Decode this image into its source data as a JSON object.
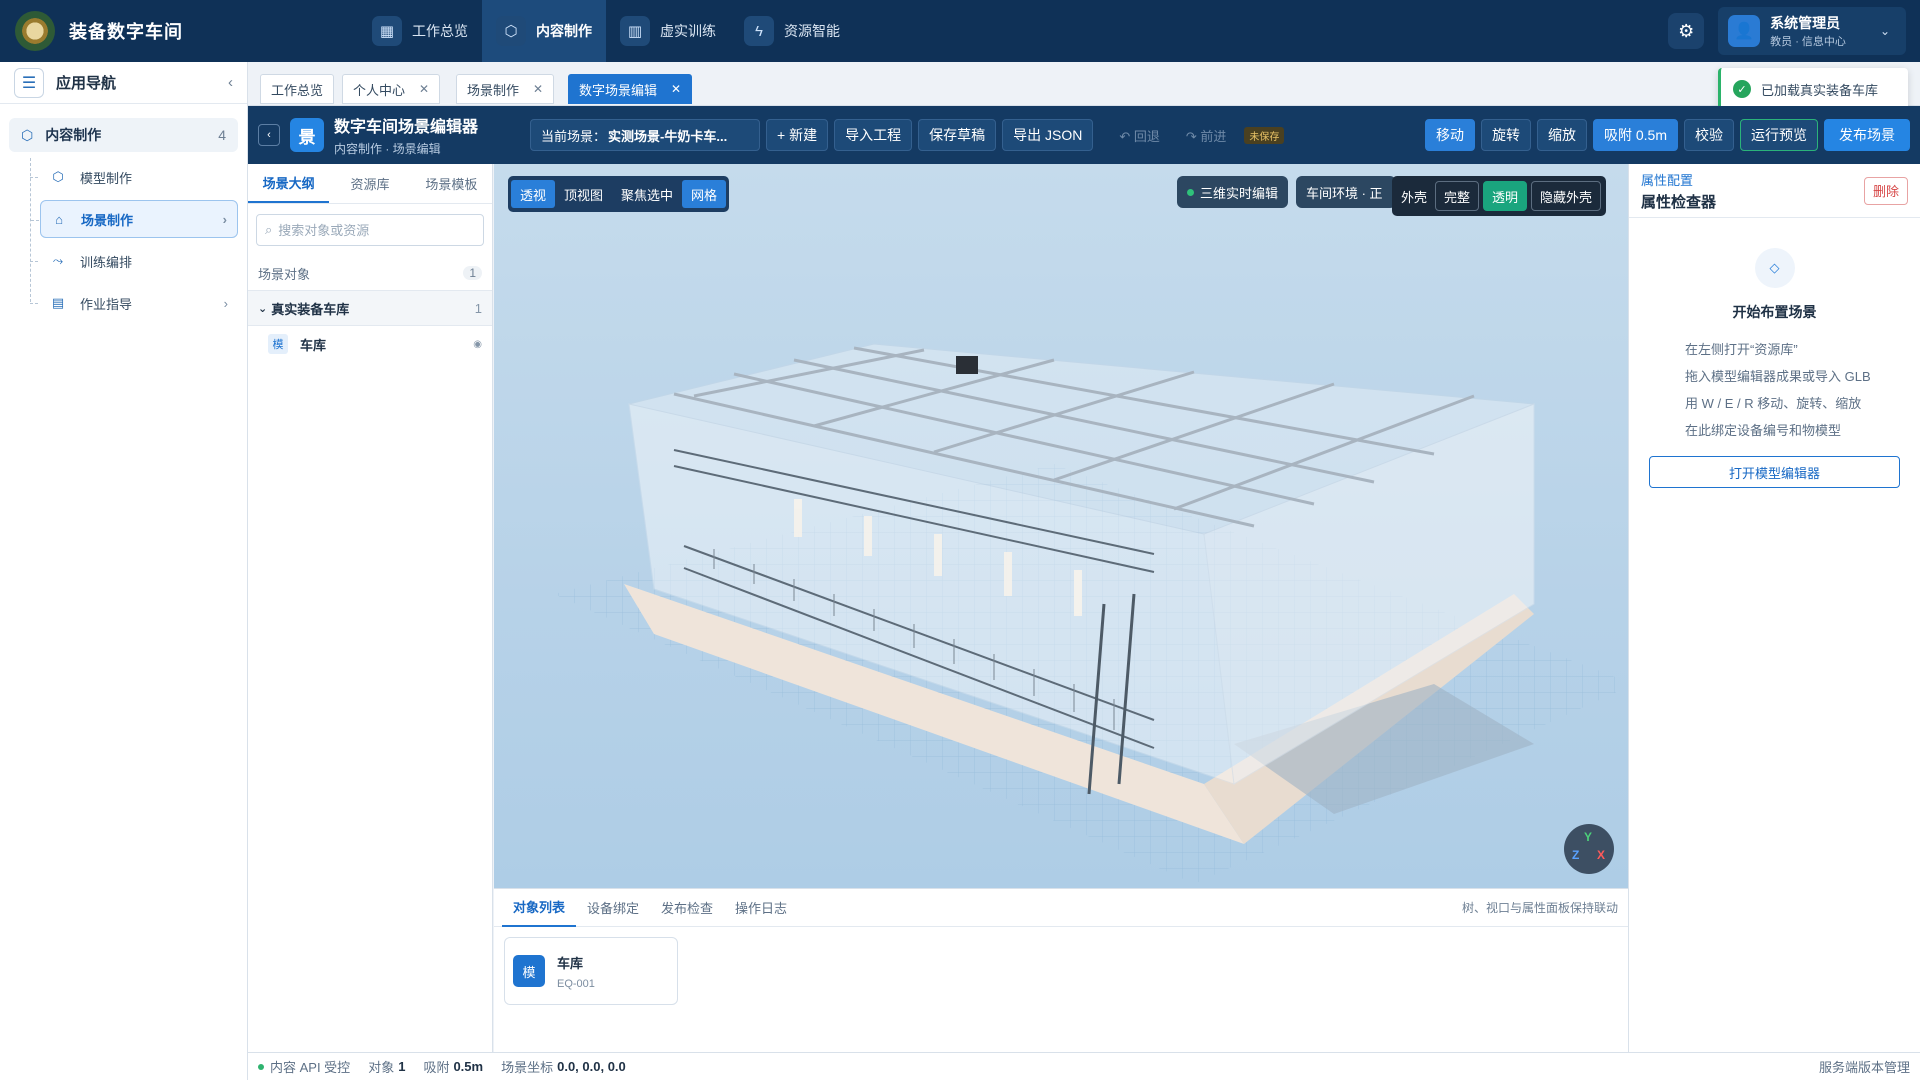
{
  "app": {
    "title": "装备数字车间"
  },
  "topnav": [
    {
      "label": "工作总览",
      "icon": "grid-icon"
    },
    {
      "label": "内容制作",
      "icon": "cube-icon"
    },
    {
      "label": "虚实训练",
      "icon": "book-icon"
    },
    {
      "label": "资源智能",
      "icon": "lightning-icon"
    }
  ],
  "user": {
    "name": "系统管理员",
    "role": "教员 · 信息中心"
  },
  "leftnav": {
    "title": "应用导航",
    "group_label": "内容制作",
    "group_count": "4",
    "items": [
      {
        "label": "模型制作"
      },
      {
        "label": "场景制作"
      },
      {
        "label": "训练编排"
      },
      {
        "label": "作业指导"
      }
    ]
  },
  "pagetabs": [
    {
      "label": "工作总览"
    },
    {
      "label": "个人中心"
    },
    {
      "label": "场景制作"
    },
    {
      "label": "数字场景编辑"
    }
  ],
  "toast": {
    "text": "已加载真实装备车库"
  },
  "editor": {
    "badge": "景",
    "title": "数字车间场景编辑器",
    "subtitle": "内容制作 · 场景编辑",
    "scene_label": "当前场景：",
    "scene_name": "实测场景-牛奶卡车...",
    "new_btn": "+ 新建",
    "import_btn": "导入工程",
    "save_btn": "保存草稿",
    "export_btn": "导出 JSON",
    "undo": "↶ 回退",
    "redo": "↷ 前进",
    "unsaved": "未保存",
    "move": "移动",
    "rotate": "旋转",
    "scale": "缩放",
    "snap": "吸附 0.5m",
    "check": "校验",
    "preview": "运行预览",
    "publish": "发布场景"
  },
  "outline": {
    "tabs": [
      "场景大纲",
      "资源库",
      "场景模板"
    ],
    "search_placeholder": "搜索对象或资源",
    "objects_label": "场景对象",
    "objects_count": "1",
    "group_name": "真实装备车库",
    "group_count": "1",
    "item_tag": "模",
    "item_name": "车库"
  },
  "viewport": {
    "view_buttons": [
      "透视",
      "顶视图",
      "聚焦选中",
      "网格"
    ],
    "live_edit": "三维实时编辑",
    "env": "车间环境 · 正",
    "shell_label": "外壳",
    "shell_full": "完整",
    "shell_transparent": "透明",
    "shell_hide": "隐藏外壳",
    "axes": {
      "y": "Y",
      "z": "Z",
      "x": "X"
    }
  },
  "bottom": {
    "tabs": [
      "对象列表",
      "设备绑定",
      "发布检查",
      "操作日志"
    ],
    "hint": "树、视口与属性面板保持联动",
    "card_tag": "模",
    "card_name": "车库",
    "card_code": "EQ-001"
  },
  "inspector": {
    "subtitle": "属性配置",
    "title": "属性检查器",
    "delete": "删除",
    "start_title": "开始布置场景",
    "steps": [
      "在左侧打开“资源库”",
      "拖入模型编辑器成果或导入 GLB",
      "用 W / E / R 移动、旋转、缩放",
      "在此绑定设备编号和物模型"
    ],
    "open_btn": "打开模型编辑器"
  },
  "status": {
    "api": "内容 API 受控",
    "objects_label": "对象",
    "objects_value": "1",
    "snap_label": "吸附",
    "snap_value": "0.5m",
    "coord_label": "场景坐标",
    "coord_value": "0.0, 0.0, 0.0",
    "right": "服务端版本管理"
  },
  "colors": {
    "topbar": "#0f3157",
    "accent": "#1f74d0",
    "success": "#25a55c",
    "danger": "#d64545"
  }
}
